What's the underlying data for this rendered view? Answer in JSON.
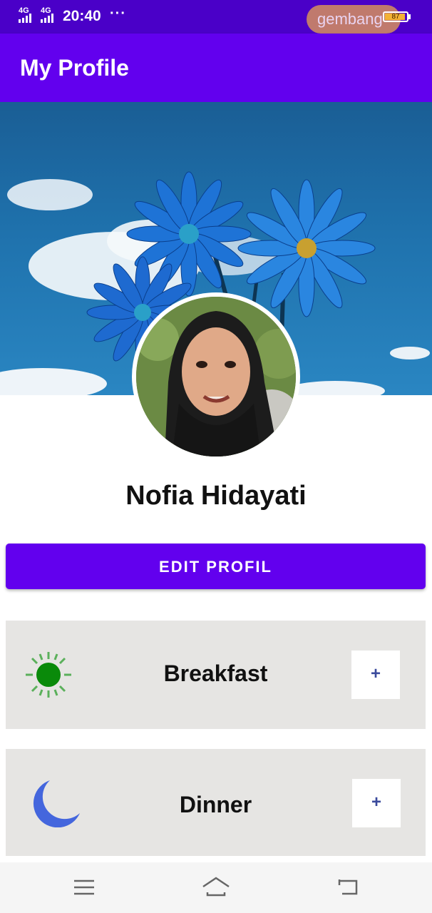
{
  "status_bar": {
    "network_1": "4G",
    "network_2": "4G",
    "time": "20:40",
    "dots": "···",
    "pill_text": "gembang",
    "battery": "87"
  },
  "app_bar": {
    "title": "My Profile"
  },
  "profile": {
    "name": "Nofia Hidayati",
    "edit_label": "EDIT PROFIL"
  },
  "meals": [
    {
      "label": "Breakfast",
      "icon": "sun-icon",
      "add_label": "+"
    },
    {
      "label": "Dinner",
      "icon": "moon-icon",
      "add_label": "+"
    }
  ],
  "nav": {
    "items": [
      "menu-icon",
      "home-icon",
      "back-icon"
    ]
  },
  "colors": {
    "primary": "#6200ee",
    "status": "#4a00c8",
    "card": "#e6e5e3"
  }
}
